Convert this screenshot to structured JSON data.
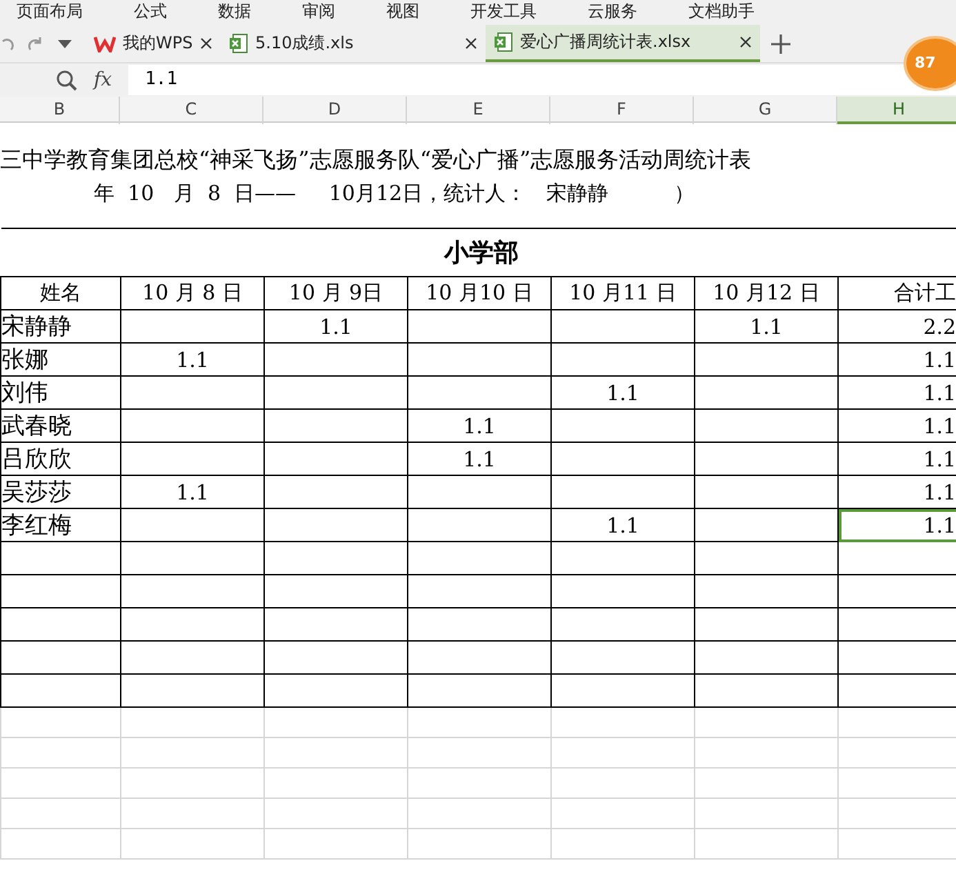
{
  "menu": [
    "页面布局",
    "公式",
    "数据",
    "审阅",
    "视图",
    "开发工具",
    "云服务",
    "文档助手"
  ],
  "tabs": [
    {
      "kind": "wps",
      "label": "我的WPS",
      "selected": false
    },
    {
      "kind": "sheet",
      "label": "5.10成绩.xls",
      "selected": false
    },
    {
      "kind": "sheet",
      "label": "爱心广播周统计表.xlsx",
      "selected": true
    }
  ],
  "badge": "87",
  "formula_bar": {
    "fx": "fx",
    "value": "1.1"
  },
  "columns": [
    {
      "label": "B",
      "selected": false
    },
    {
      "label": "C",
      "selected": false
    },
    {
      "label": "D",
      "selected": false
    },
    {
      "label": "E",
      "selected": false
    },
    {
      "label": "F",
      "selected": false
    },
    {
      "label": "G",
      "selected": false
    },
    {
      "label": "H",
      "selected": true
    }
  ],
  "sheet": {
    "title": "三中学教育集团总校“神采飞扬”志愿服务队“爱心广播”志愿服务活动周统计表",
    "subtitle": "年  10   月  8  日——     10月12日，统计人：   宋静静          ）",
    "section": "小学部",
    "header": [
      "姓名",
      "10 月 8 日",
      "10 月 9日",
      "10 月10 日",
      "10 月11 日",
      "10 月12 日",
      "合计工"
    ],
    "rows": [
      {
        "name": "宋静静",
        "day_2": "1.1",
        "day_5": "1.1",
        "total": "2.2",
        "selected": false
      },
      {
        "name": "张娜",
        "day_1": "1.1",
        "total": "1.1",
        "selected": false
      },
      {
        "name": "刘伟",
        "day_4": "1.1",
        "total": "1.1",
        "selected": false
      },
      {
        "name": "武春晓",
        "day_3": "1.1",
        "total": "1.1",
        "selected": false
      },
      {
        "name": "吕欣欣",
        "day_3": "1.1",
        "total": "1.1",
        "selected": false
      },
      {
        "name": "吴莎莎",
        "day_1": "1.1",
        "total": "1.1",
        "selected": false
      },
      {
        "name": "李红梅",
        "day_4": "1.1",
        "total": "1.1",
        "selected": true
      }
    ]
  }
}
